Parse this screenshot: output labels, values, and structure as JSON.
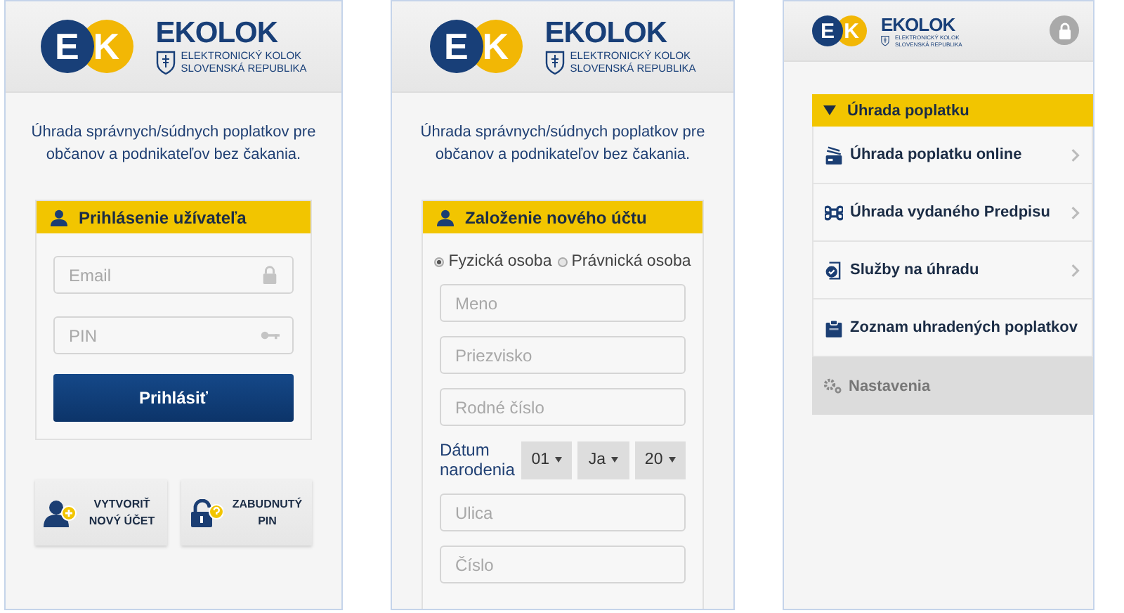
{
  "login_screen": {
    "header": {
      "logo": {
        "mark_left": "E",
        "mark_right": "K",
        "wordmark": "EKOLOK",
        "subtitle": [
          "ELEKTRONICKÝ KOLOK",
          "SLOVENSKÁ REPUBLIKA"
        ]
      }
    },
    "tagline": "Úhrada správnych/súdnych poplatkov pre občanov a podnikateľov bez čakania.",
    "card": {
      "title": "Prihlásenie užívateľa",
      "fields": [
        {
          "placeholder": "Email",
          "kind": "lock"
        },
        {
          "placeholder": "PIN",
          "kind": "key"
        }
      ],
      "button": "Prihlásiť"
    },
    "actions": [
      {
        "label": [
          "VYTVORIŤ",
          "NOVÝ ÚČET"
        ],
        "kind": "new-account"
      },
      {
        "label": [
          "ZABUDNUTÝ",
          "PIN"
        ],
        "kind": "forgot"
      }
    ]
  },
  "registration_screen": {
    "header": {
      "logo": {
        "mark_left": "E",
        "mark_right": "K",
        "wordmark": "EKOLOK",
        "subtitle": [
          "ELEKTRONICKÝ KOLOK",
          "SLOVENSKÁ REPUBLIKA"
        ]
      }
    },
    "tagline": "Úhrada správnych/súdnych poplatkov pre občanov a podnikateľov bez čakania.",
    "card": {
      "title": "Založenie nového účtu",
      "person_types": [
        {
          "label": "Fyzická osoba",
          "selected": true
        },
        {
          "label": "Právnická osoba",
          "selected": false
        }
      ],
      "fields_before_date": [
        {
          "placeholder": "Meno"
        },
        {
          "placeholder": "Priezvisko"
        },
        {
          "placeholder": "Rodné číslo"
        }
      ],
      "birth_date": {
        "label": "Dátum narodenia",
        "selects": [
          "01",
          "Ja",
          "20"
        ]
      },
      "fields_after_date": [
        {
          "placeholder": "Ulica"
        },
        {
          "placeholder": "Číslo"
        }
      ]
    }
  },
  "menu_screen": {
    "header": {
      "logo": {
        "mark_left": "E",
        "mark_right": "K",
        "wordmark": "EKOLOK",
        "subtitle": [
          "ELEKTRONICKÝ KOLOK",
          "SLOVENSKÁ REPUBLIKA"
        ]
      }
    },
    "menu": {
      "section": {
        "title": "Úhrada poplatku",
        "expanded": true
      },
      "items": [
        {
          "label": "Úhrada poplatku online",
          "kind": "card"
        },
        {
          "label": "Úhrada vydaného Predpisu",
          "kind": "command"
        },
        {
          "label": "Služby na úhradu",
          "kind": "document"
        },
        {
          "label": "Zoznam uhradených poplatkov",
          "kind": "clipboard"
        }
      ],
      "settings": {
        "label": "Nastavenia",
        "disabled": true
      }
    }
  }
}
